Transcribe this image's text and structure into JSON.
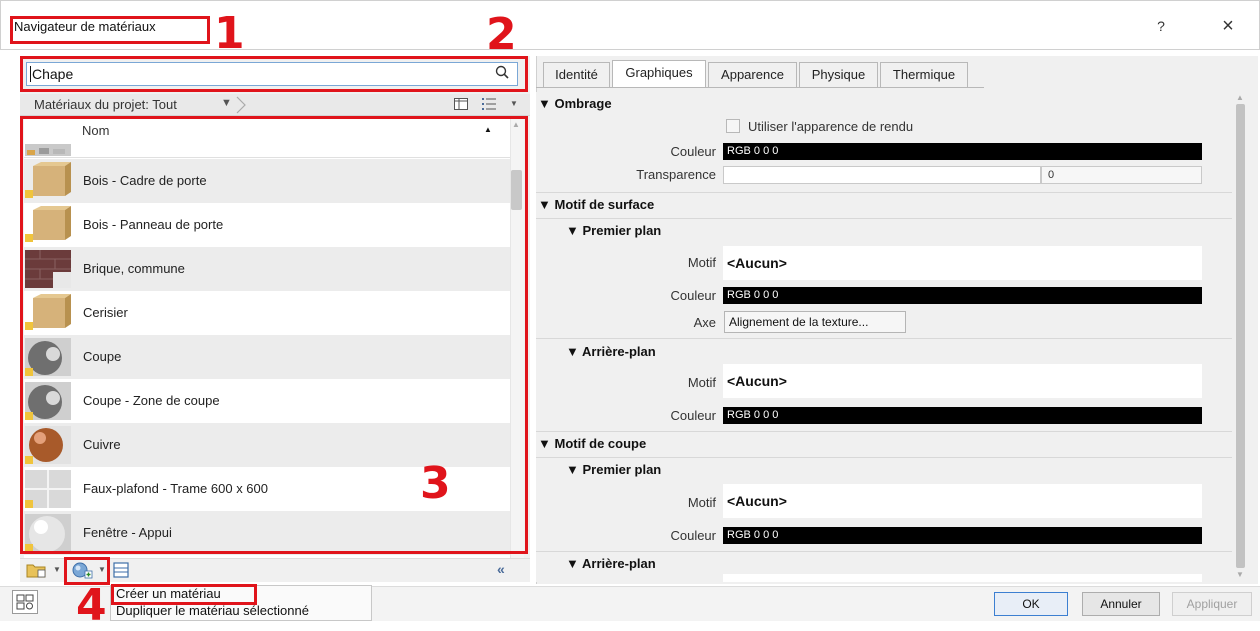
{
  "window": {
    "title": "Navigateur de matériaux",
    "help_label": "?",
    "close_label": "×"
  },
  "search": {
    "value": "Chape"
  },
  "filter": {
    "label": "Matériaux du projet: Tout",
    "chevron": "▼"
  },
  "list": {
    "header_label": "Nom",
    "items": [
      {
        "label": "Bois - Cadre de porte",
        "thumb": "wood"
      },
      {
        "label": "Bois - Panneau de porte",
        "thumb": "wood"
      },
      {
        "label": "Brique, commune",
        "thumb": "brick"
      },
      {
        "label": "Cerisier",
        "thumb": "wood"
      },
      {
        "label": "Coupe",
        "thumb": "grey-sphere"
      },
      {
        "label": "Coupe - Zone de coupe",
        "thumb": "grey-sphere"
      },
      {
        "label": "Cuivre",
        "thumb": "copper-sphere"
      },
      {
        "label": "Faux-plafond - Trame 600 x 600",
        "thumb": "ceiling-grid"
      },
      {
        "label": "Fenêtre - Appui",
        "thumb": "white-sphere"
      }
    ]
  },
  "menu": {
    "create": "Créer un matériau",
    "duplicate": "Dupliquer le matériau sélectionné"
  },
  "buttons": {
    "ok": "OK",
    "cancel": "Annuler",
    "apply": "Appliquer"
  },
  "tabs": [
    "Identité",
    "Graphiques",
    "Apparence",
    "Physique",
    "Thermique"
  ],
  "active_tab": "Graphiques",
  "props": {
    "ombrage": {
      "title": "Ombrage",
      "use_render_appearance": "Utiliser l'apparence de rendu",
      "color_label": "Couleur",
      "color_value": "RGB 0 0 0",
      "transparency_label": "Transparence",
      "transparency_value": "0"
    },
    "surface": {
      "title": "Motif de surface",
      "premier_plan": "Premier plan",
      "motif_label": "Motif",
      "motif_value": "<Aucun>",
      "color_label": "Couleur",
      "color_value": "RGB 0 0 0",
      "axe_label": "Axe",
      "axe_value": "Alignement de la texture...",
      "arriere_plan": "Arrière-plan",
      "motif2_label": "Motif",
      "motif2_value": "<Aucun>",
      "color2_label": "Couleur",
      "color2_value": "RGB 0 0 0"
    },
    "coupe": {
      "title": "Motif de coupe",
      "premier_plan": "Premier plan",
      "motif_label": "Motif",
      "motif_value": "<Aucun>",
      "color_label": "Couleur",
      "color_value": "RGB 0 0 0",
      "arriere_plan": "Arrière-plan"
    }
  },
  "annotations": [
    "1",
    "2",
    "3",
    "4"
  ],
  "colors": {
    "annotation_red": "#e0141b",
    "accent_blue": "#3c7fd1"
  }
}
